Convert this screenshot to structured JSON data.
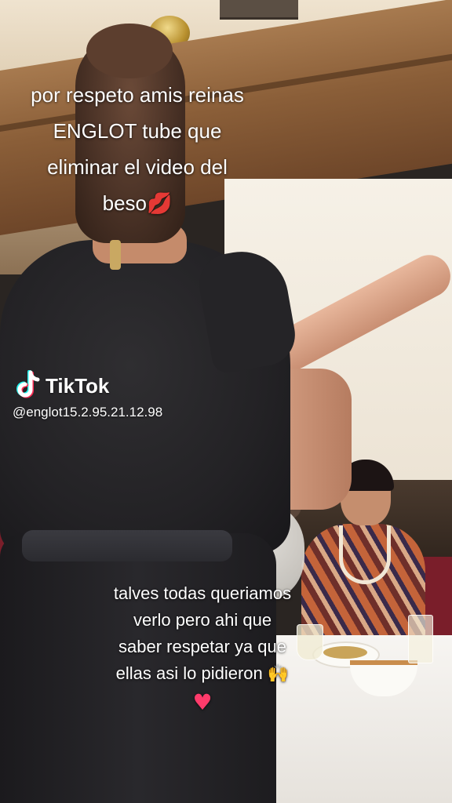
{
  "overlay": {
    "top_caption": {
      "line1": "por respeto amis reinas",
      "line2": "ENGLOT tube que",
      "line3": "eliminar el video del",
      "line4": "beso",
      "emoji": "💋"
    },
    "watermark": {
      "brand": "TikTok",
      "handle": "@englot15.2.95.21.12.98"
    },
    "bottom_caption": {
      "line1": "talves todas queriamos",
      "line2": "verlo pero ahi que",
      "line3": "saber respetar ya que",
      "line4": "ellas asi lo pidieron",
      "emoji_hands": "🙌",
      "emoji_heart": "♥"
    }
  },
  "icons": {
    "watermark_logo": "tiktok-logo-icon",
    "kiss": "kiss-mark-icon",
    "hands": "raised-hands-icon",
    "heart": "heart-icon"
  },
  "colors": {
    "text": "#ffffff",
    "tiktok_cyan": "#25f4ee",
    "tiktok_red": "#fe2c55",
    "heart": "#ff3b6b"
  }
}
